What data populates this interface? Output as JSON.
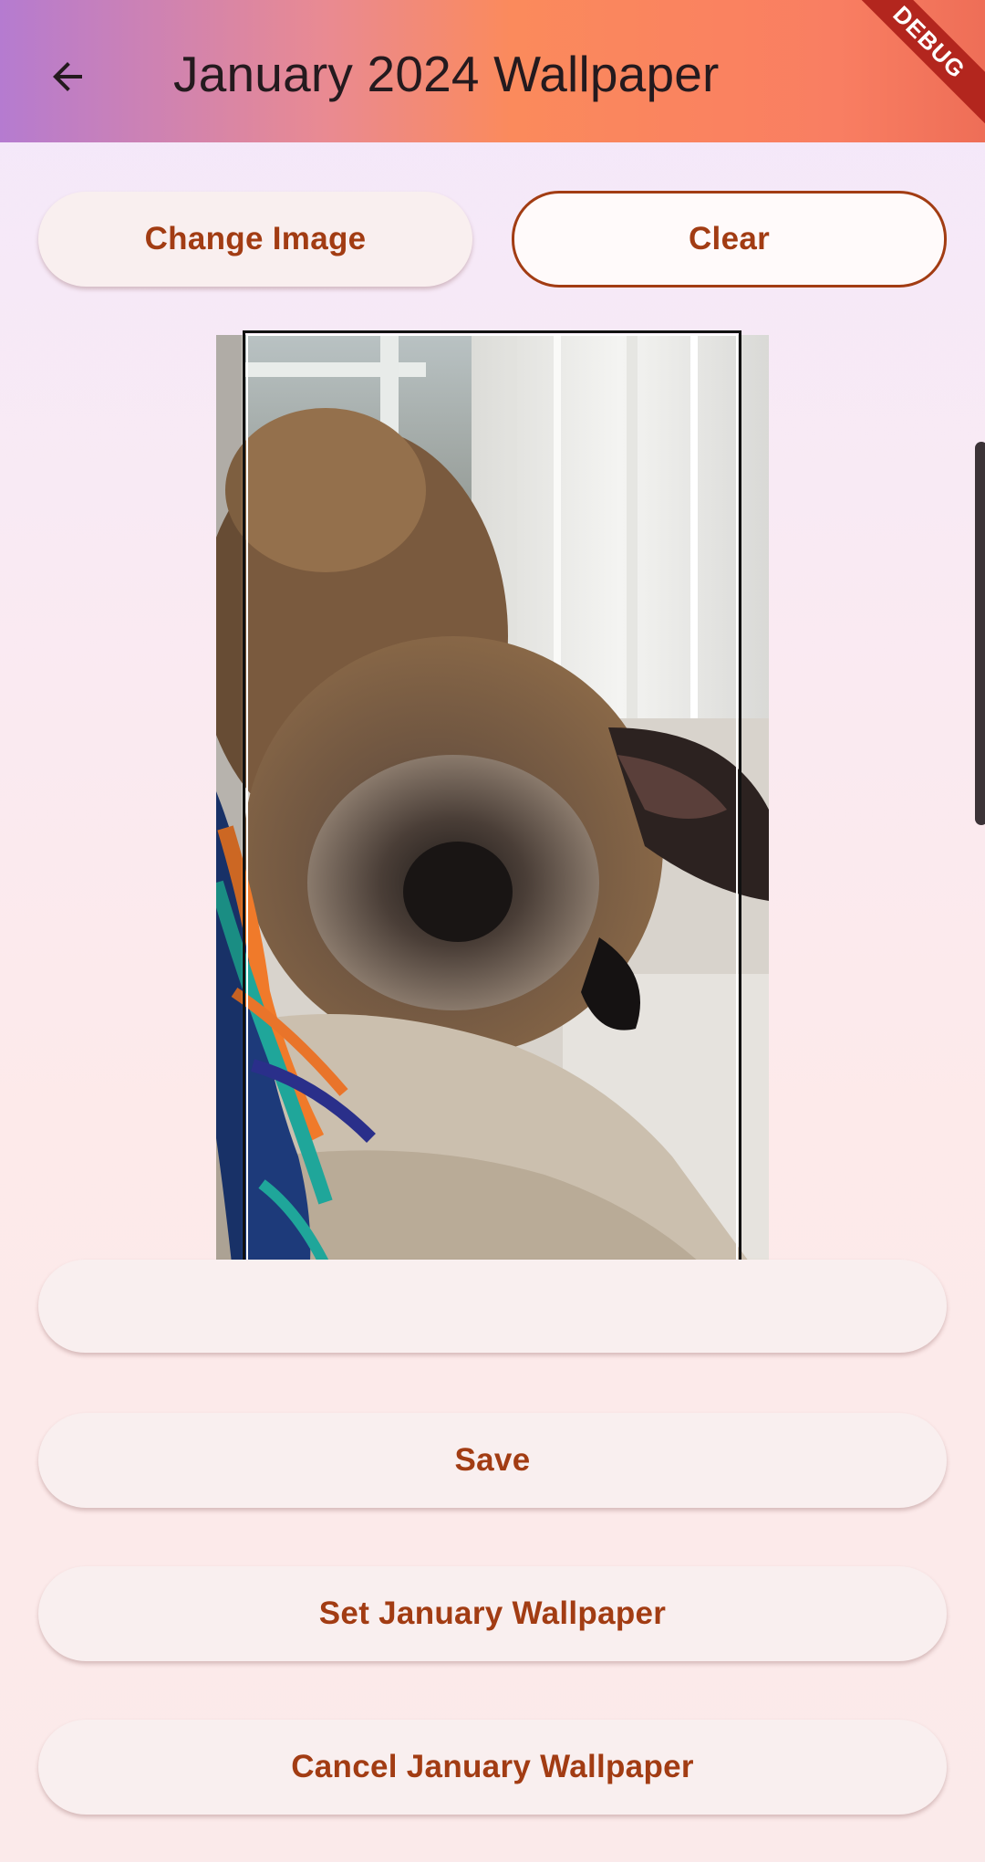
{
  "appbar": {
    "title": "January 2024 Wallpaper",
    "back_icon": "arrow-left-icon",
    "debug_label": "DEBUG"
  },
  "toolbar": {
    "change_image_label": "Change Image",
    "clear_label": "Clear"
  },
  "actions": {
    "save_label": "Save",
    "set_wallpaper_label": "Set January Wallpaper",
    "cancel_wallpaper_label": "Cancel January Wallpaper"
  },
  "colors": {
    "accent": "#a23c13",
    "appbar_start": "#b57bd0",
    "appbar_end": "#ee6e57",
    "debug_banner": "#b3261e"
  }
}
